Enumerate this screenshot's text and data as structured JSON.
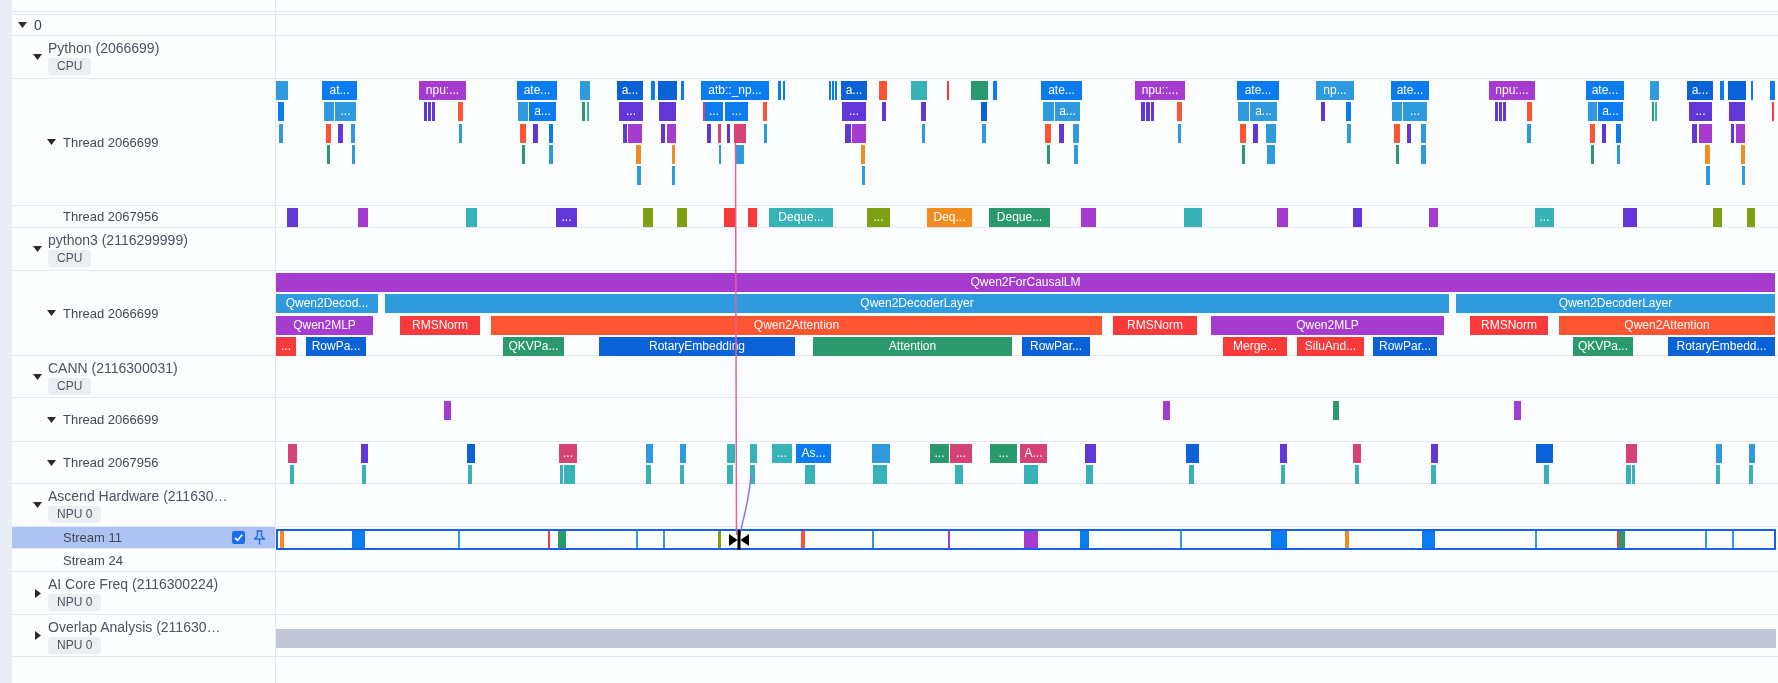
{
  "tree": {
    "label": "0",
    "expanded": true,
    "processes": [
      {
        "name": "Python (2066699)",
        "badge": "CPU",
        "expanded": true,
        "threads": [
          {
            "name": "Thread 2066699",
            "expanded": true,
            "selected": false,
            "slices": [
              {
                "color": "#309ade"
              },
              {
                "label": "at...",
                "color": "#0b7bf0"
              },
              {
                "label": "npu:...",
                "color": "#a63bcf"
              },
              {
                "label": "ate...",
                "color": "#0b7bf0"
              },
              {
                "color": "#309ade"
              },
              {
                "label": "a...",
                "color": "#0962d6"
              },
              {
                "color": "#0b7bf0"
              },
              {
                "color": "#0962d6"
              },
              {
                "color": "#0b7bf0"
              },
              {
                "label": "atb::_np...",
                "color": "#0b7bf0"
              },
              {
                "color": "#0b7bf0"
              },
              {
                "color": "#0b7bf0"
              },
              {
                "color": "#0b7bf0"
              },
              {
                "color": "#0b7bf0"
              },
              {
                "color": "#0b7bf0"
              },
              {
                "label": "a...",
                "color": "#0962d6"
              },
              {
                "color": "#fd5532"
              },
              {
                "color": "#37b2b6"
              },
              {
                "color": "#f83a3a"
              },
              {
                "color": "#2a9a6c"
              },
              {
                "color": "#0b7bf0"
              },
              {
                "label": "ate...",
                "color": "#0b7bf0"
              },
              {
                "label": "npu::...",
                "color": "#a63bcf"
              },
              {
                "label": "ate...",
                "color": "#0b7bf0"
              },
              {
                "label": "np...",
                "color": "#309ade"
              },
              {
                "label": "ate...",
                "color": "#0b7bf0"
              },
              {
                "label": "npu:...",
                "color": "#a63bcf"
              },
              {
                "label": "ate...",
                "color": "#0b7bf0"
              },
              {
                "color": "#309ade"
              },
              {
                "label": "a...",
                "color": "#0962d6"
              },
              {
                "color": "#0b7bf0"
              },
              {
                "color": "#0962d6"
              },
              {
                "color": "#0b7bf0"
              },
              {
                "color": "#0b7bf0"
              },
              {
                "color": "#0b7bf0"
              },
              {
                "color": "#309ade"
              },
              {
                "label": "...",
                "color": "#309ade"
              },
              {
                "color": "#6237d8"
              },
              {
                "color": "#6237d8"
              },
              {
                "color": "#6237d8"
              },
              {
                "color": "#fd5532"
              },
              {
                "color": "#309ade"
              },
              {
                "label": "a...",
                "color": "#0b7bf0"
              },
              {
                "color": "#2a9a6c"
              },
              {
                "color": "#37b2b6"
              },
              {
                "label": "...",
                "color": "#6237d8"
              },
              {
                "color": "#6237d8"
              },
              {
                "color": "#d54275"
              },
              {
                "label": "...",
                "color": "#0b7bf0"
              },
              {
                "label": "...",
                "color": "#0b7bf0"
              },
              {
                "color": "#fd5532"
              },
              {
                "label": "...",
                "color": "#6237d8"
              },
              {
                "color": "#6237d8"
              },
              {
                "color": "#6237d8"
              },
              {
                "color": "#0962d6"
              },
              {
                "color": "#309ade"
              },
              {
                "label": "a...",
                "color": "#309ade"
              },
              {
                "color": "#6237d8"
              },
              {
                "color": "#6237d8"
              },
              {
                "color": "#6237d8"
              },
              {
                "color": "#fd5532"
              },
              {
                "color": "#309ade"
              },
              {
                "label": "a...",
                "color": "#309ade"
              },
              {
                "color": "#6237d8"
              },
              {
                "color": "#0b7bf0"
              },
              {
                "color": "#309ade"
              },
              {
                "label": "...",
                "color": "#309ade"
              },
              {
                "color": "#6237d8"
              },
              {
                "color": "#6237d8"
              },
              {
                "color": "#6237d8"
              },
              {
                "color": "#fd5532"
              },
              {
                "color": "#309ade"
              },
              {
                "label": "a...",
                "color": "#0b7bf0"
              },
              {
                "color": "#2a9a6c"
              },
              {
                "color": "#37b2b6"
              },
              {
                "label": "...",
                "color": "#6237d8"
              },
              {
                "color": "#6237d8"
              },
              {
                "color": "#f83a3a"
              },
              {
                "color": "#309ade"
              },
              {
                "color": "#fd5532"
              },
              {
                "color": "#6237d8"
              },
              {
                "color": "#309ade"
              },
              {
                "color": "#309ade"
              },
              {
                "color": "#fd5532"
              },
              {
                "color": "#6237d8"
              },
              {
                "color": "#0b7bf0"
              },
              {
                "color": "#6237d8"
              },
              {
                "color": "#a63bcf"
              },
              {
                "color": "#6237d8"
              },
              {
                "color": "#a63bcf"
              },
              {
                "color": "#6237d8"
              },
              {
                "color": "#d54275"
              },
              {
                "color": "#6237d8"
              },
              {
                "color": "#d54275"
              },
              {
                "color": "#309ade"
              },
              {
                "color": "#6237d8"
              },
              {
                "color": "#a63bcf"
              },
              {
                "color": "#309ade"
              },
              {
                "color": "#309ade"
              },
              {
                "color": "#fd5532"
              },
              {
                "color": "#6237d8"
              },
              {
                "color": "#309ade"
              },
              {
                "color": "#309ade"
              },
              {
                "color": "#fd5532"
              },
              {
                "color": "#6237d8"
              },
              {
                "color": "#309ade"
              },
              {
                "color": "#309ade"
              },
              {
                "color": "#fd5532"
              },
              {
                "color": "#6237d8"
              },
              {
                "color": "#309ade"
              },
              {
                "color": "#309ade"
              },
              {
                "color": "#fd5532"
              },
              {
                "color": "#6237d8"
              },
              {
                "color": "#0b7bf0"
              },
              {
                "color": "#6237d8"
              },
              {
                "color": "#a63bcf"
              },
              {
                "color": "#6237d8"
              },
              {
                "color": "#a63bcf"
              },
              {
                "color": "#2a9a6c"
              },
              {
                "color": "#309ade"
              },
              {
                "color": "#2a9a6c"
              },
              {
                "color": "#309ade"
              },
              {
                "color": "#f28c1e"
              },
              {
                "color": "#f28c1e"
              },
              {
                "color": "#309ade"
              },
              {
                "color": "#309ade"
              },
              {
                "color": "#f28c1e"
              },
              {
                "color": "#2a9a6c"
              },
              {
                "color": "#309ade"
              },
              {
                "color": "#2a9a6c"
              },
              {
                "color": "#309ade"
              },
              {
                "color": "#2a9a6c"
              },
              {
                "color": "#309ade"
              },
              {
                "color": "#2a9a6c"
              },
              {
                "color": "#309ade"
              },
              {
                "color": "#f28c1e"
              },
              {
                "color": "#f28c1e"
              },
              {
                "color": "#309ade"
              },
              {
                "color": "#309ade"
              },
              {
                "color": "#309ade"
              },
              {
                "color": "#309ade"
              },
              {
                "color": "#309ade"
              }
            ]
          },
          {
            "name": "Thread 2067956",
            "selected": false,
            "slices": [
              {
                "color": "#6237d8"
              },
              {
                "color": "#a63bcf"
              },
              {
                "color": "#37b2b6"
              },
              {
                "label": "...",
                "color": "#6237d8"
              },
              {
                "color": "#7ba112"
              },
              {
                "color": "#7ba112"
              },
              {
                "color": "#f83a3a"
              },
              {
                "color": "#f83a3a"
              },
              {
                "label": "Deque...",
                "color": "#37b2b6"
              },
              {
                "label": "...",
                "color": "#7ba112"
              },
              {
                "label": "Deq...",
                "color": "#f28c1e"
              },
              {
                "label": "Deque...",
                "color": "#2a9a6c"
              },
              {
                "color": "#a63bcf"
              },
              {
                "color": "#37b2b6"
              },
              {
                "color": "#a63bcf"
              },
              {
                "color": "#6237d8"
              },
              {
                "color": "#a63bcf"
              },
              {
                "label": "...",
                "color": "#37b2b6"
              },
              {
                "color": "#6237d8"
              },
              {
                "color": "#7ba112"
              },
              {
                "color": "#7ba112"
              }
            ]
          }
        ]
      },
      {
        "name": "python3 (2116299999)",
        "badge": "CPU",
        "expanded": true,
        "threads": [
          {
            "name": "Thread 2066699",
            "expanded": true,
            "selected": false,
            "slices": [
              {
                "label": "Qwen2ForCausalLM",
                "color": "#a63bcf"
              },
              {
                "label": "Qwen2Decod...",
                "color": "#309ade"
              },
              {
                "label": "Qwen2DecoderLayer",
                "color": "#309ade"
              },
              {
                "label": "Qwen2DecoderLayer",
                "color": "#309ade"
              },
              {
                "label": "Qwen2MLP",
                "color": "#a63bcf"
              },
              {
                "label": "RMSNorm",
                "color": "#f83a3a"
              },
              {
                "label": "Qwen2Attention",
                "color": "#fd5532"
              },
              {
                "label": "RMSNorm",
                "color": "#f83a3a"
              },
              {
                "label": "Qwen2MLP",
                "color": "#a63bcf"
              },
              {
                "label": "RMSNorm",
                "color": "#f83a3a"
              },
              {
                "label": "Qwen2Attention",
                "color": "#fd5532"
              },
              {
                "label": "...",
                "color": "#f83a3a"
              },
              {
                "label": "RowPa...",
                "color": "#0962d6"
              },
              {
                "label": "QKVPa...",
                "color": "#2a9a6c"
              },
              {
                "label": "RotaryEmbedding",
                "color": "#0962d6"
              },
              {
                "label": "Attention",
                "color": "#2a9a6c"
              },
              {
                "label": "RowPar...",
                "color": "#0962d6"
              },
              {
                "label": "Merge...",
                "color": "#f83a3a"
              },
              {
                "label": "SiluAnd...",
                "color": "#f83a3a"
              },
              {
                "label": "RowPar...",
                "color": "#0962d6"
              },
              {
                "label": "QKVPa...",
                "color": "#2a9a6c"
              },
              {
                "label": "RotaryEmbedd...",
                "color": "#0962d6"
              }
            ]
          }
        ]
      },
      {
        "name": "CANN (2116300031)",
        "badge": "CPU",
        "expanded": true,
        "threads": [
          {
            "name": "Thread 2066699",
            "expanded": true,
            "selected": false,
            "slices": [
              {
                "color": "#a63bcf"
              },
              {
                "color": "#a63bcf"
              },
              {
                "color": "#2a9a6c"
              },
              {
                "color": "#a63bcf"
              }
            ]
          },
          {
            "name": "Thread 2067956",
            "expanded": true,
            "selected": false,
            "slices": [
              {
                "color": "#d54275"
              },
              {
                "color": "#6237d8"
              },
              {
                "color": "#0962d6"
              },
              {
                "label": "...",
                "color": "#d54275"
              },
              {
                "color": "#309ade"
              },
              {
                "color": "#309ade"
              },
              {
                "color": "#37b2b6"
              },
              {
                "color": "#37b2b6"
              },
              {
                "label": "...",
                "color": "#37b2b6"
              },
              {
                "label": "As...",
                "color": "#0b7bf0"
              },
              {
                "color": "#309ade"
              },
              {
                "label": "...",
                "color": "#2a9a6c"
              },
              {
                "label": "...",
                "color": "#d54275"
              },
              {
                "label": "...",
                "color": "#2a9a6c"
              },
              {
                "label": "A...",
                "color": "#d54275"
              },
              {
                "color": "#6237d8"
              },
              {
                "color": "#0962d6"
              },
              {
                "color": "#6237d8"
              },
              {
                "color": "#d54275"
              },
              {
                "color": "#6237d8"
              },
              {
                "color": "#0962d6"
              },
              {
                "color": "#d54275"
              },
              {
                "color": "#309ade"
              },
              {
                "color": "#309ade"
              },
              {
                "color": "#37b2b6"
              },
              {
                "color": "#37b2b6"
              },
              {
                "color": "#37b2b6"
              },
              {
                "color": "#37b2b6"
              },
              {
                "color": "#37b2b6"
              },
              {
                "color": "#37b2b6"
              },
              {
                "color": "#37b2b6"
              },
              {
                "color": "#37b2b6"
              },
              {
                "color": "#37b2b6"
              },
              {
                "color": "#37b2b6"
              },
              {
                "color": "#37b2b6"
              },
              {
                "color": "#37b2b6"
              },
              {
                "color": "#37b2b6"
              },
              {
                "color": "#37b2b6"
              },
              {
                "color": "#37b2b6"
              },
              {
                "color": "#37b2b6"
              },
              {
                "color": "#37b2b6"
              },
              {
                "color": "#37b2b6"
              },
              {
                "color": "#37b2b6"
              },
              {
                "color": "#37b2b6"
              },
              {
                "color": "#37b2b6"
              },
              {
                "color": "#37b2b6"
              },
              {
                "color": "#37b2b6"
              }
            ]
          }
        ]
      },
      {
        "name": "Ascend Hardware (211630…",
        "badge": "NPU 0",
        "expanded": true,
        "threads": [
          {
            "name": "Stream 11",
            "selected": true,
            "checked": true,
            "slices": [
              {
                "color": "#f28c1e"
              },
              {
                "color": "#0b7bf0"
              },
              {
                "color": "#309ade"
              },
              {
                "color": "#f83a3a"
              },
              {
                "color": "#2a9a6c"
              },
              {
                "color": "#309ade"
              },
              {
                "color": "#309ade"
              },
              {
                "color": "#7ba112"
              },
              {
                "color": "#fd5532"
              },
              {
                "color": "#309ade"
              },
              {
                "color": "#a63bcf"
              },
              {
                "color": "#a63bcf"
              },
              {
                "color": "#0b7bf0"
              },
              {
                "color": "#309ade"
              },
              {
                "color": "#0b7bf0"
              },
              {
                "color": "#f28c1e"
              },
              {
                "color": "#0b7bf0"
              },
              {
                "color": "#309ade"
              },
              {
                "color": "#f83a3a"
              },
              {
                "color": "#2a9a6c"
              },
              {
                "color": "#309ade"
              },
              {
                "color": "#309ade"
              }
            ]
          },
          {
            "name": "Stream 24",
            "selected": false
          }
        ]
      },
      {
        "name": "AI Core Freq (2116300224)",
        "badge": "NPU 0",
        "expanded": false
      },
      {
        "name": "Overlap Analysis (211630…",
        "badge": "NPU 0",
        "expanded": false,
        "summary": [
          {
            "color": "#c1c7d6"
          }
        ]
      }
    ]
  },
  "flows": [
    {
      "color": "#e8609a"
    },
    {
      "color": "#8a72e8"
    }
  ]
}
